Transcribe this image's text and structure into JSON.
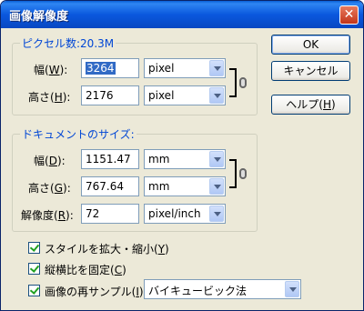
{
  "dialog": {
    "title": "画像解像度",
    "close_glyph": "✕"
  },
  "pixel_dimensions": {
    "legend": "ピクセル数:20.3M",
    "width_label": "幅",
    "width_key": "W",
    "width_value": "3264",
    "width_unit": "pixel",
    "height_label": "高さ",
    "height_key": "H",
    "height_value": "2176",
    "height_unit": "pixel"
  },
  "document_size": {
    "legend": "ドキュメントのサイズ:",
    "width_label": "幅",
    "width_key": "D",
    "width_value": "1151.47",
    "width_unit": "mm",
    "height_label": "高さ",
    "height_key": "G",
    "height_value": "767.64",
    "height_unit": "mm",
    "resolution_label": "解像度",
    "resolution_key": "R",
    "resolution_value": "72",
    "resolution_unit": "pixel/inch"
  },
  "buttons": {
    "ok": "OK",
    "cancel": "キャンセル",
    "help_label": "ヘルプ",
    "help_key": "H"
  },
  "options": {
    "scale_styles_label": "スタイルを拡大・縮小",
    "scale_styles_key": "Y",
    "scale_styles_checked": true,
    "constrain_label": "縦横比を固定",
    "constrain_key": "C",
    "constrain_checked": true,
    "resample_label": "画像の再サンプル",
    "resample_key": "I",
    "resample_checked": true,
    "resample_method": "バイキュービック法"
  },
  "colors": {
    "titlebar": "#0a58de",
    "legend_text": "#0046d5",
    "dialog_bg": "#ece9d8",
    "selection": "#316ac5"
  }
}
